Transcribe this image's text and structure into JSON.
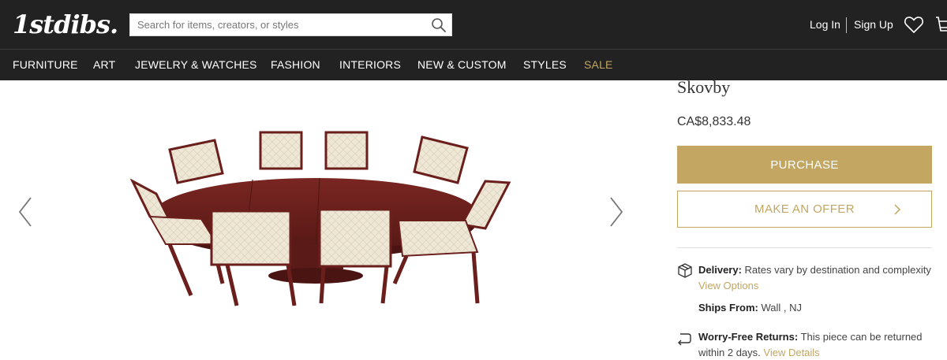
{
  "header": {
    "logo": "1stdibs.",
    "search_placeholder": "Search for items, creators, or styles",
    "login": "Log In",
    "signup": "Sign Up"
  },
  "nav": {
    "items": [
      "FURNITURE",
      "ART",
      "JEWELRY & WATCHES",
      "FASHION",
      "INTERIORS",
      "NEW & CUSTOM",
      "STYLES",
      "SALE"
    ]
  },
  "product": {
    "seller": "Skovby",
    "price": "CA$8,833.48",
    "purchase_label": "PURCHASE",
    "offer_label": "MAKE AN OFFER"
  },
  "shipping": {
    "delivery_label": "Delivery:",
    "delivery_text": "Rates vary by destination and complexity",
    "view_options": "View Options",
    "ships_from_label": "Ships From:",
    "ships_from_value": "Wall , NJ",
    "returns_label": "Worry-Free Returns:",
    "returns_text": "This piece can be returned within 2 days.",
    "view_details": "View Details"
  },
  "colors": {
    "header_bg": "#222222",
    "accent_gold": "#c2a661",
    "wood": "#6b1f1c"
  },
  "icons": [
    "search-icon",
    "heart-icon",
    "cart-icon",
    "chevron-left-icon",
    "chevron-right-icon",
    "box-icon",
    "return-arrow-icon"
  ]
}
